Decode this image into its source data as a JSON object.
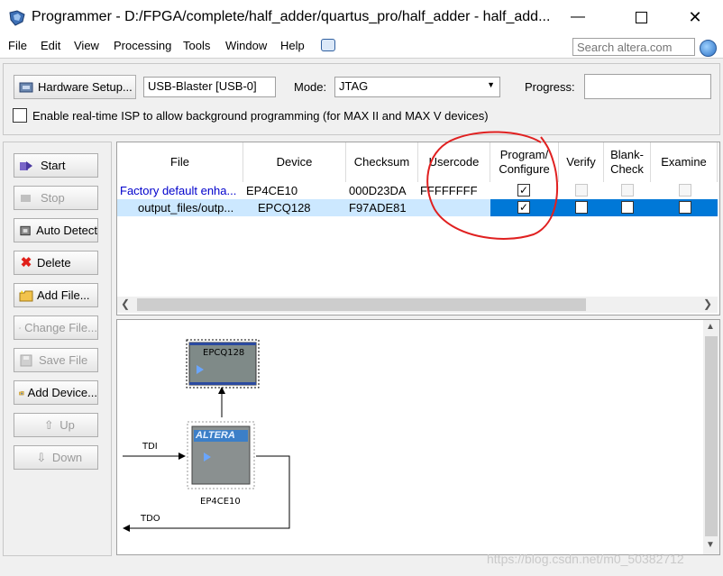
{
  "window": {
    "title": "Programmer - D:/FPGA/complete/half_adder/quartus_pro/half_adder - half_add..."
  },
  "menu": {
    "items": [
      "File",
      "Edit",
      "View",
      "Processing",
      "Tools",
      "Window",
      "Help"
    ],
    "search_placeholder": "Search altera.com"
  },
  "toolbar": {
    "hardware_setup_label": "Hardware Setup...",
    "hardware_value": "USB-Blaster [USB-0]",
    "mode_label": "Mode:",
    "mode_value": "JTAG",
    "progress_label": "Progress:",
    "isp_label": "Enable real-time ISP to allow background programming (for MAX II and MAX V devices)"
  },
  "side_buttons": [
    {
      "label": "Start",
      "enabled": true,
      "icon": "start-icon"
    },
    {
      "label": "Stop",
      "enabled": false,
      "icon": "stop-icon"
    },
    {
      "label": "Auto Detect",
      "enabled": true,
      "icon": "auto-detect-icon"
    },
    {
      "label": "Delete",
      "enabled": true,
      "icon": "delete-icon"
    },
    {
      "label": "Add File...",
      "enabled": true,
      "icon": "add-file-icon"
    },
    {
      "label": "Change File...",
      "enabled": false,
      "icon": "change-file-icon"
    },
    {
      "label": "Save File",
      "enabled": false,
      "icon": "save-file-icon"
    },
    {
      "label": "Add Device...",
      "enabled": true,
      "icon": "add-device-icon"
    },
    {
      "label": "Up",
      "enabled": false,
      "icon": "up-icon"
    },
    {
      "label": "Down",
      "enabled": false,
      "icon": "down-icon"
    }
  ],
  "table": {
    "columns": [
      "File",
      "Device",
      "Checksum",
      "Usercode",
      "Program/\nConfigure",
      "Verify",
      "Blank-\nCheck",
      "Examine"
    ],
    "rows": [
      {
        "file": "Factory default enha...",
        "device": "EP4CE10",
        "checksum": "000D23DA",
        "usercode": "FFFFFFFF",
        "program": true,
        "selected": false
      },
      {
        "file": "output_files/outp...",
        "device": "EPCQ128",
        "checksum": "F97ADE81",
        "usercode": "",
        "program": true,
        "selected": true
      }
    ]
  },
  "diagram": {
    "flash_label": "EPCQ128",
    "fpga_logo": "ALTERA",
    "fpga_label": "EP4CE10",
    "tdi_label": "TDI",
    "tdo_label": "TDO"
  },
  "watermark": "https://blog.csdn.net/m0_50382712",
  "colors": {
    "selection": "#0078d7",
    "selection_light": "#cce8ff",
    "annotation": "#e02020",
    "link_text": "#0000cc"
  }
}
